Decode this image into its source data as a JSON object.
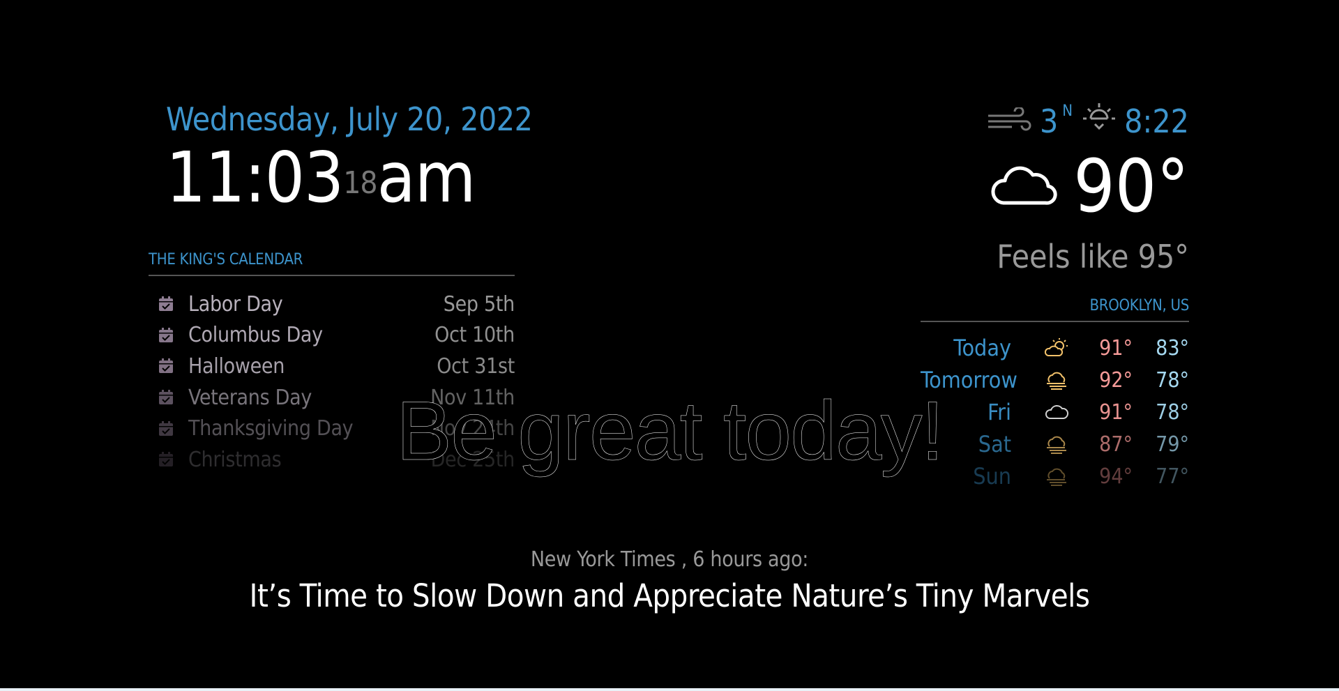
{
  "clock": {
    "date": "Wednesday, July 20, 2022",
    "time": "11:03",
    "seconds": "18",
    "ampm": "am"
  },
  "calendar": {
    "header": "THE KING'S CALENDAR",
    "events": [
      {
        "title": "Labor Day",
        "date": "Sep 5th",
        "opacity": 1.0
      },
      {
        "title": "Columbus Day",
        "date": "Oct 10th",
        "opacity": 0.95
      },
      {
        "title": "Halloween",
        "date": "Oct 31st",
        "opacity": 0.9
      },
      {
        "title": "Veterans Day",
        "date": "Nov 11th",
        "opacity": 0.65
      },
      {
        "title": "Thanksgiving Day",
        "date": "Nov 24th",
        "opacity": 0.45
      },
      {
        "title": "Christmas",
        "date": "Dec 25th",
        "opacity": 0.25
      }
    ],
    "icon": "calendar-check-icon"
  },
  "current_weather": {
    "wind_speed": "3",
    "wind_direction": "N",
    "sunrise_time": "8:22",
    "temperature": "90°",
    "feels_like": "Feels like 95°",
    "icon": "cloud-icon"
  },
  "forecast": {
    "header": "BROOKLYN, US",
    "days": [
      {
        "day": "Today",
        "icon": "partly-sunny-icon",
        "high": "91°",
        "low": "83°",
        "opacity": 1.0
      },
      {
        "day": "Tomorrow",
        "icon": "haze-icon",
        "high": "92°",
        "low": "78°",
        "opacity": 1.0
      },
      {
        "day": "Fri",
        "icon": "cloudy-icon",
        "high": "91°",
        "low": "78°",
        "opacity": 0.95
      },
      {
        "day": "Sat",
        "icon": "haze-icon",
        "high": "87°",
        "low": "79°",
        "opacity": 0.7
      },
      {
        "day": "Sun",
        "icon": "haze-icon",
        "high": "94°",
        "low": "77°",
        "opacity": 0.4
      }
    ]
  },
  "compliment": "Be great today!",
  "news": {
    "source": "New York Times , 6 hours ago:",
    "title": "It’s Time to Slow Down and Appreciate Nature’s Tiny Marvels"
  },
  "colors": {
    "accent": "#3d94cc",
    "background": "#000000",
    "high_temp": "#f59a98",
    "low_temp": "#a5d8f0",
    "dim_text": "#999999"
  }
}
